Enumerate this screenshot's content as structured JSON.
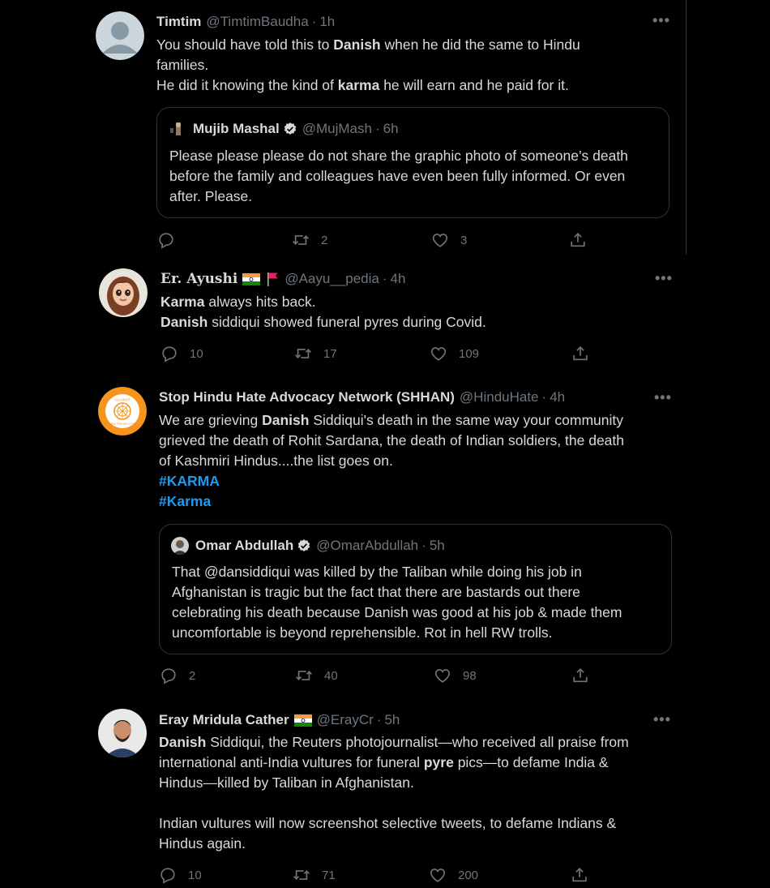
{
  "tweets": [
    {
      "name": "Timtim",
      "handle": "@TimtimBaudha",
      "time": "1h",
      "lines": [
        [
          {
            "t": "You should have told this to "
          },
          {
            "t": "Danish",
            "b": true
          },
          {
            "t": " when he did the same to Hindu"
          }
        ],
        [
          {
            "t": "families."
          }
        ],
        [
          {
            "t": "He did it knowing the kind of "
          },
          {
            "t": "karma",
            "b": true
          },
          {
            "t": " he will earn and he paid for it."
          }
        ]
      ],
      "quote": {
        "name": "Mujib Mashal",
        "handle": "@MujMash",
        "time": "6h",
        "lines": [
          "Please please please do not share the graphic photo of someone’s death",
          "before the family and colleagues have even been fully informed. Or even",
          "after. Please."
        ]
      },
      "reply_count": "",
      "retweet_count": "2",
      "like_count": "3"
    },
    {
      "name": "Er. Ayushi",
      "handle": "@Aayu__pedia",
      "time": "4h",
      "lines": [
        [
          {
            "t": "Karma",
            "b": true
          },
          {
            "t": " always hits back."
          }
        ],
        [
          {
            "t": "Danish",
            "b": true
          },
          {
            "t": " siddiqui showed funeral pyres during Covid."
          }
        ]
      ],
      "reply_count": "10",
      "retweet_count": "17",
      "like_count": "109"
    },
    {
      "name": "Stop Hindu Hate Advocacy Network (SHHAN)",
      "handle": "@HinduHate",
      "time": "4h",
      "lines": [
        [
          {
            "t": "We are grieving "
          },
          {
            "t": "Danish",
            "b": true
          },
          {
            "t": " Siddiqui's death in the same way your community"
          }
        ],
        [
          {
            "t": "grieved the death of Rohit Sardana, the death of Indian soldiers, the death"
          }
        ],
        [
          {
            "t": "of Kashmiri Hindus....the list goes on."
          }
        ]
      ],
      "hashtags": [
        "#KARMA",
        "#Karma"
      ],
      "quote": {
        "name": "Omar Abdullah",
        "handle": "@OmarAbdullah",
        "time": "5h",
        "lines": [
          "That @dansiddiqui was killed by the Taliban while doing his job in",
          "Afghanistan is tragic but the fact that there are bastards out there",
          "celebrating his death because Danish was good at his job & made them",
          "uncomfortable is beyond reprehensible. Rot in hell RW trolls."
        ]
      },
      "reply_count": "2",
      "retweet_count": "40",
      "like_count": "98"
    },
    {
      "name": "Eray Mridula Cather",
      "handle": "@ErayCr",
      "time": "5h",
      "lines": [
        [
          {
            "t": "Danish",
            "b": true
          },
          {
            "t": " Siddiqui, the Reuters photojournalist—who received all praise from"
          }
        ],
        [
          {
            "t": "international anti-India vultures for funeral "
          },
          {
            "t": "pyre",
            "b": true
          },
          {
            "t": " pics—to defame India &"
          }
        ],
        [
          {
            "t": "Hindus—killed by Taliban in Afghanistan."
          }
        ],
        [
          {
            "t": ""
          }
        ],
        [
          {
            "t": "Indian vultures will now screenshot selective tweets, to defame Indians &"
          }
        ],
        [
          {
            "t": "Hindus again."
          }
        ]
      ],
      "reply_count": "10",
      "retweet_count": "71",
      "like_count": "200"
    }
  ],
  "separator": "·",
  "more_label": "•••",
  "colors": {
    "background": "#000000",
    "text": "#d9d9d9",
    "muted": "#6e767d",
    "link": "#1d9bf0",
    "border": "#2f3336"
  },
  "avatar_badge_text": [
    "AGAINST",
    "HINDU PERSECUTION"
  ]
}
